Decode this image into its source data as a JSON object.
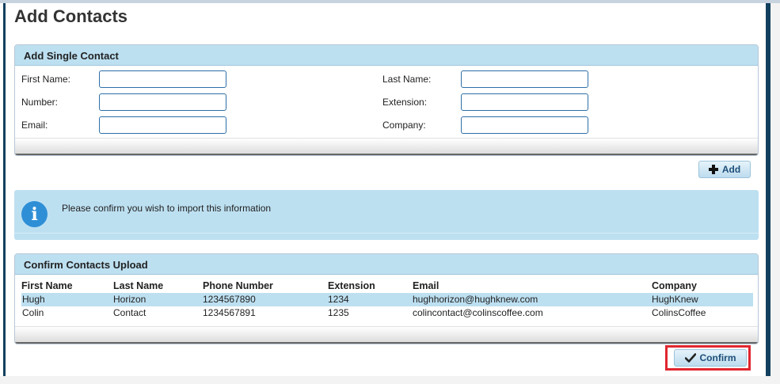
{
  "page": {
    "title": "Add Contacts"
  },
  "single_contact": {
    "header": "Add Single Contact",
    "fields": {
      "first_name": {
        "label": "First Name:",
        "value": ""
      },
      "last_name": {
        "label": "Last Name:",
        "value": ""
      },
      "number": {
        "label": "Number:",
        "value": ""
      },
      "extension": {
        "label": "Extension:",
        "value": ""
      },
      "email": {
        "label": "Email:",
        "value": ""
      },
      "company": {
        "label": "Company:",
        "value": ""
      }
    },
    "add_button": "Add"
  },
  "info": {
    "icon": "info-icon",
    "message": "Please confirm you wish to import this information"
  },
  "confirm_upload": {
    "header": "Confirm Contacts Upload",
    "columns": [
      "First Name",
      "Last Name",
      "Phone Number",
      "Extension",
      "Email",
      "Company"
    ],
    "rows": [
      [
        "Hugh",
        "Horizon",
        "1234567890",
        "1234",
        "hughhorizon@hughknew.com",
        "HughKnew"
      ],
      [
        "Colin",
        "Contact",
        "1234567891",
        "1235",
        "colincontact@colinscoffee.com",
        "ColinsCoffee"
      ]
    ],
    "highlighted_row": 0,
    "confirm_button": "Confirm"
  },
  "colors": {
    "panel_header": "#bde0f1",
    "accent_dark": "#12405e",
    "input_border": "#2e6fa8",
    "highlight_box": "#e0262f"
  }
}
